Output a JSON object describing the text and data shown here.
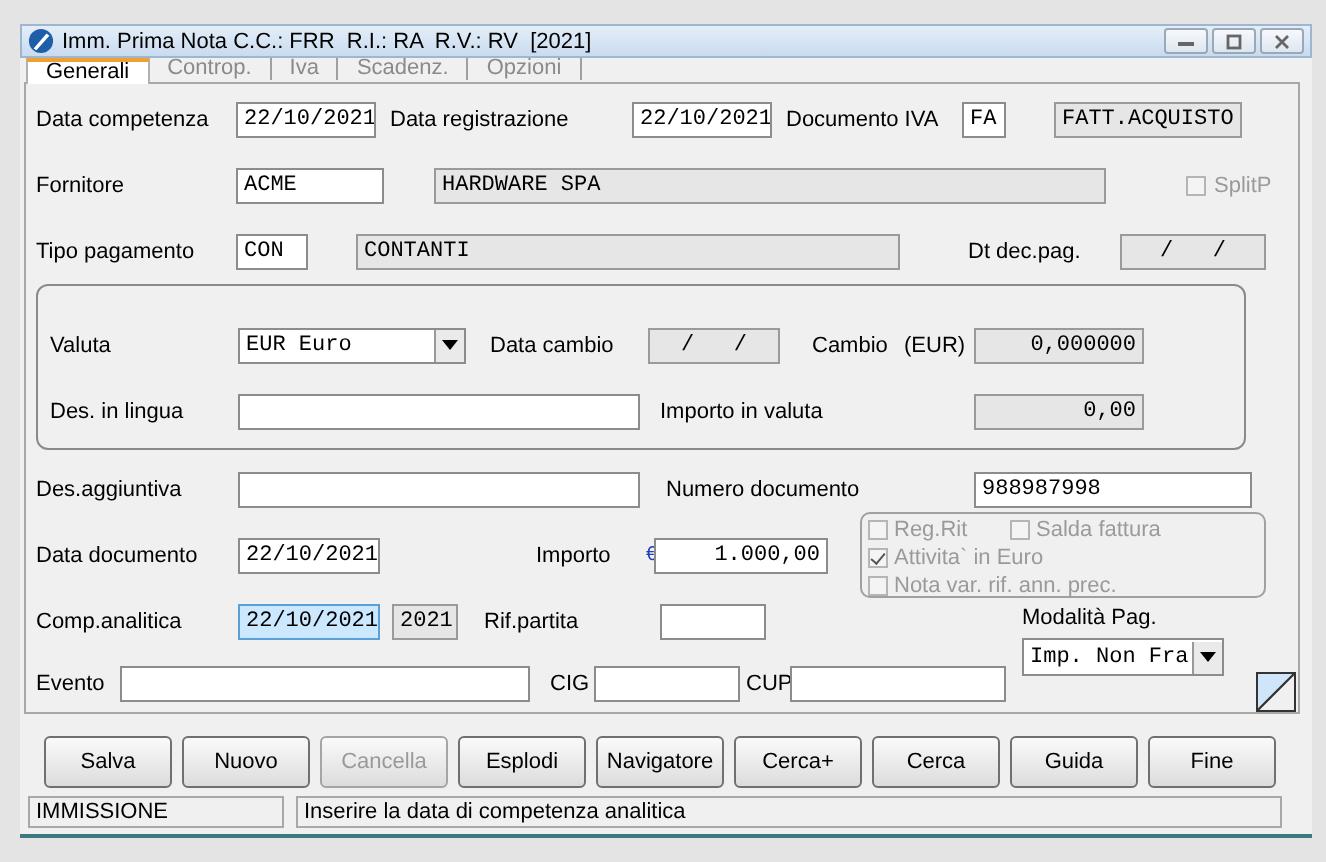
{
  "window": {
    "title": "Imm. Prima Nota C.C.: FRR  R.I.: RA  R.V.: RV  [2021]"
  },
  "tabs": [
    {
      "label": "Generali",
      "selected": true
    },
    {
      "label": "Controp.",
      "selected": false
    },
    {
      "label": "Iva",
      "selected": false
    },
    {
      "label": "Scadenz.",
      "selected": false
    },
    {
      "label": "Opzioni",
      "selected": false
    }
  ],
  "general": {
    "data_competenza": {
      "label": "Data competenza",
      "value": "22/10/2021"
    },
    "data_registrazione": {
      "label": "Data registrazione",
      "value": "22/10/2021"
    },
    "documento_iva": {
      "label": "Documento IVA",
      "code": "FA",
      "description": "FATT.ACQUISTO"
    },
    "fornitore": {
      "label": "Fornitore",
      "code": "ACME",
      "description": "HARDWARE SPA"
    },
    "split_p": {
      "label": "SplitP",
      "checked": false,
      "disabled": true
    },
    "tipo_pagamento": {
      "label": "Tipo pagamento",
      "code": "CON",
      "description": "CONTANTI"
    },
    "dt_dec_pag": {
      "label": "Dt dec.pag.",
      "value": "/   /"
    },
    "valuta": {
      "label": "Valuta",
      "value": "EUR Euro"
    },
    "data_cambio": {
      "label": "Data cambio",
      "value": "/   /"
    },
    "cambio": {
      "label": "Cambio",
      "unit": "(EUR)",
      "value": "0,000000"
    },
    "des_in_lingua": {
      "label": "Des. in lingua"
    },
    "importo_in_valuta": {
      "label": "Importo in valuta",
      "value": "0,00"
    },
    "des_aggiuntiva": {
      "label": "Des.aggiuntiva"
    },
    "numero_documento": {
      "label": "Numero documento",
      "value": "988987998"
    },
    "data_documento": {
      "label": "Data documento",
      "value": "22/10/2021"
    },
    "importo": {
      "label": "Importo",
      "currency": "€",
      "value": "1.000,00"
    },
    "options": [
      {
        "label": "Reg.Rit",
        "checked": false,
        "disabled": true
      },
      {
        "label": "Salda fattura",
        "checked": false,
        "disabled": true
      },
      {
        "label": "Attivita` in Euro",
        "checked": true,
        "disabled": true
      },
      {
        "label": "Nota var. rif. ann. prec.",
        "checked": false,
        "disabled": true
      }
    ],
    "comp_analitica": {
      "label": "Comp.analitica",
      "value": "22/10/2021",
      "selected": true,
      "year": "2021"
    },
    "rif_partita": {
      "label": "Rif.partita"
    },
    "modalita_pag": {
      "label": "Modalità Pag.",
      "value": "Imp. Non Fra"
    },
    "evento": {
      "label": "Evento"
    },
    "cig": {
      "label": "CIG"
    },
    "cup": {
      "label": "CUP"
    }
  },
  "buttons": [
    {
      "label": "Salva",
      "disabled": false
    },
    {
      "label": "Nuovo",
      "disabled": false
    },
    {
      "label": "Cancella",
      "disabled": true
    },
    {
      "label": "Esplodi",
      "disabled": false
    },
    {
      "label": "Navigatore",
      "disabled": false
    },
    {
      "label": "Cerca+",
      "disabled": false
    },
    {
      "label": "Cerca",
      "disabled": false
    },
    {
      "label": "Guida",
      "disabled": false
    },
    {
      "label": "Fine",
      "disabled": false
    }
  ],
  "status_bar": {
    "mode": "IMMISSIONE",
    "message": "Inserire la data di competenza analitica"
  }
}
